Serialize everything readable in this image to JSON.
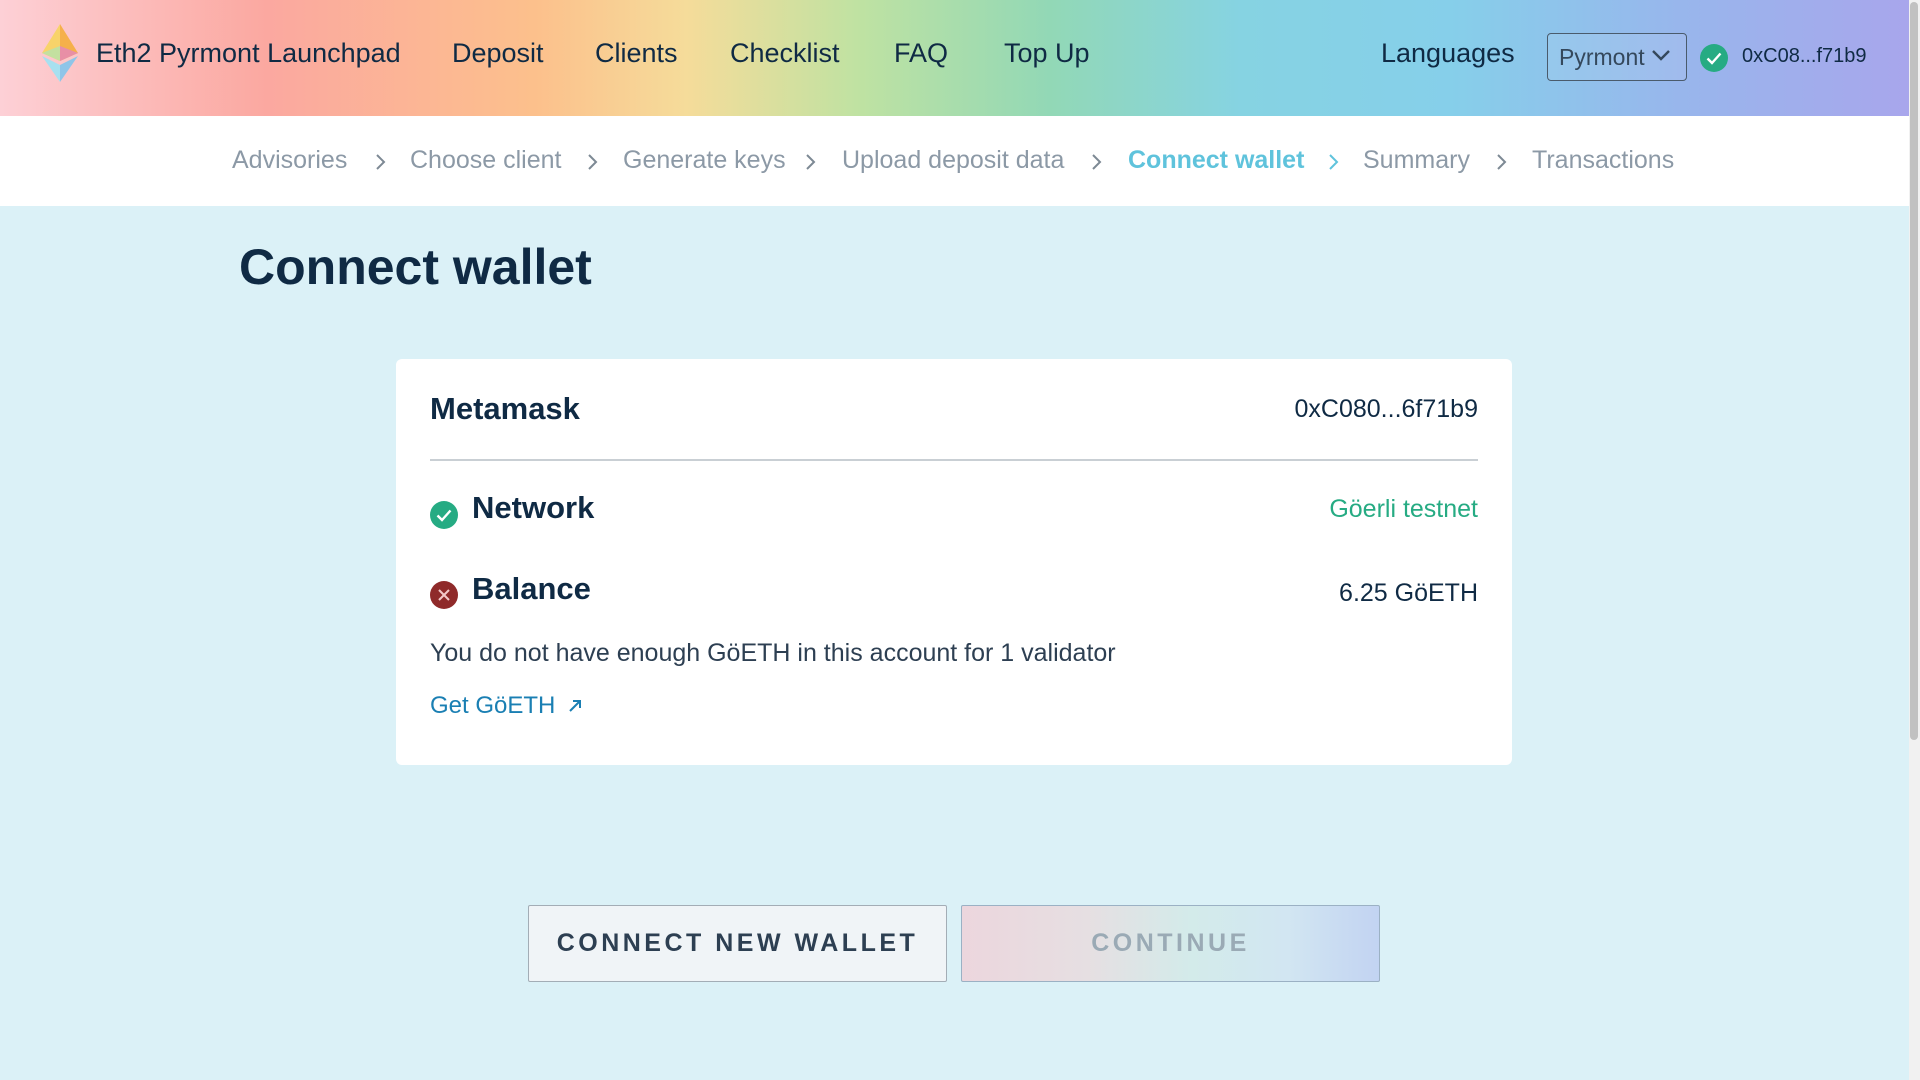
{
  "header": {
    "brand": "Eth2 Pyrmont Launchpad",
    "nav": [
      "Deposit",
      "Clients",
      "Checklist",
      "FAQ",
      "Top Up"
    ],
    "languages": "Languages",
    "network_select": "Pyrmont",
    "account": "0xC08...f71b9"
  },
  "steps": [
    "Advisories",
    "Choose client",
    "Generate keys",
    "Upload deposit data",
    "Connect wallet",
    "Summary",
    "Transactions"
  ],
  "active_step": "Connect wallet",
  "page": {
    "title": "Connect wallet"
  },
  "wallet": {
    "name": "Metamask",
    "address": "0xC080...6f71b9",
    "network_label": "Network",
    "network_value": "Göerli testnet",
    "balance_label": "Balance",
    "balance_value": "6.25 GöETH",
    "warning": "You do not have enough GöETH in this account for 1 validator",
    "get_link": "Get GöETH"
  },
  "buttons": {
    "connect_new": "CONNECT NEW WALLET",
    "continue": "CONTINUE"
  },
  "colors": {
    "active_step": "#5fc3dc",
    "success": "#26ab83",
    "error": "#8f2a2a",
    "network_value": "#26ab83",
    "link": "#1a7fb3",
    "background": "#dbf1f7"
  },
  "icons": {
    "logo": "ethereum-diamond-icon",
    "step_separator": "chevron-right-icon",
    "network_status": "check-circle-icon",
    "balance_status": "x-circle-icon",
    "external_link": "arrow-up-right-icon"
  }
}
